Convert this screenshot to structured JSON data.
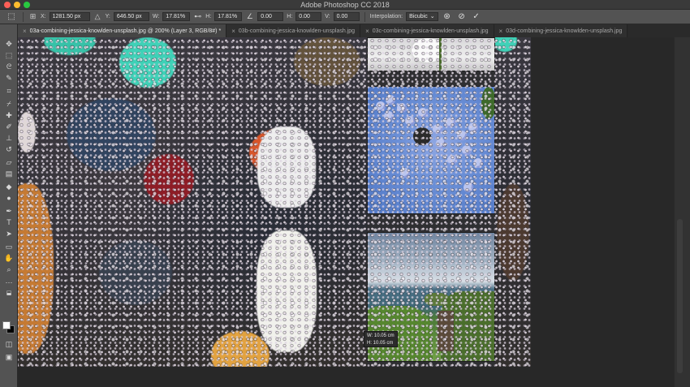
{
  "window": {
    "title": "Adobe Photoshop CC 2018"
  },
  "options_bar": {
    "x_label": "X:",
    "x_value": "1281.50 px",
    "y_label": "Y:",
    "y_value": "646.50 px",
    "w_label": "W:",
    "w_value": "17.81%",
    "h_label": "H:",
    "h_value": "17.81%",
    "angle_value": "0.00",
    "skew_h_label": "H:",
    "skew_h_value": "0.00",
    "skew_v_label": "V:",
    "skew_v_value": "0.00",
    "interpolation_label": "Interpolation:",
    "interpolation_value": "Bicubic"
  },
  "tabs": [
    {
      "label": "03a-combining-jessica-knowlden-unsplash.jpg @ 200% (Layer 3, RGB/8#) *",
      "active": true
    },
    {
      "label": "03b-combining-jessica-knowlden-unsplash.jpg",
      "active": false
    },
    {
      "label": "03c-combining-jessica-knowlden-unsplash.jpg",
      "active": false
    },
    {
      "label": "03d-combining-jessica-knowlden-unsplash.jpg",
      "active": false
    }
  ],
  "transform_tooltip": {
    "width": "W: 10.05 cm",
    "height": "H: 10.05 cm"
  },
  "icons": {
    "tools": [
      "move-icon",
      "marquee-icon",
      "lasso-icon",
      "quick-select-icon",
      "crop-icon",
      "eyedropper-icon",
      "healing-icon",
      "brush-icon",
      "stamp-icon",
      "history-brush-icon",
      "eraser-icon",
      "gradient-icon",
      "blur-icon",
      "dodge-icon",
      "pen-icon",
      "type-icon",
      "path-select-icon",
      "rectangle-icon",
      "hand-icon",
      "zoom-icon",
      "more-tools-icon"
    ]
  },
  "colors": {
    "foreground": "#ffffff",
    "background": "#000000"
  }
}
